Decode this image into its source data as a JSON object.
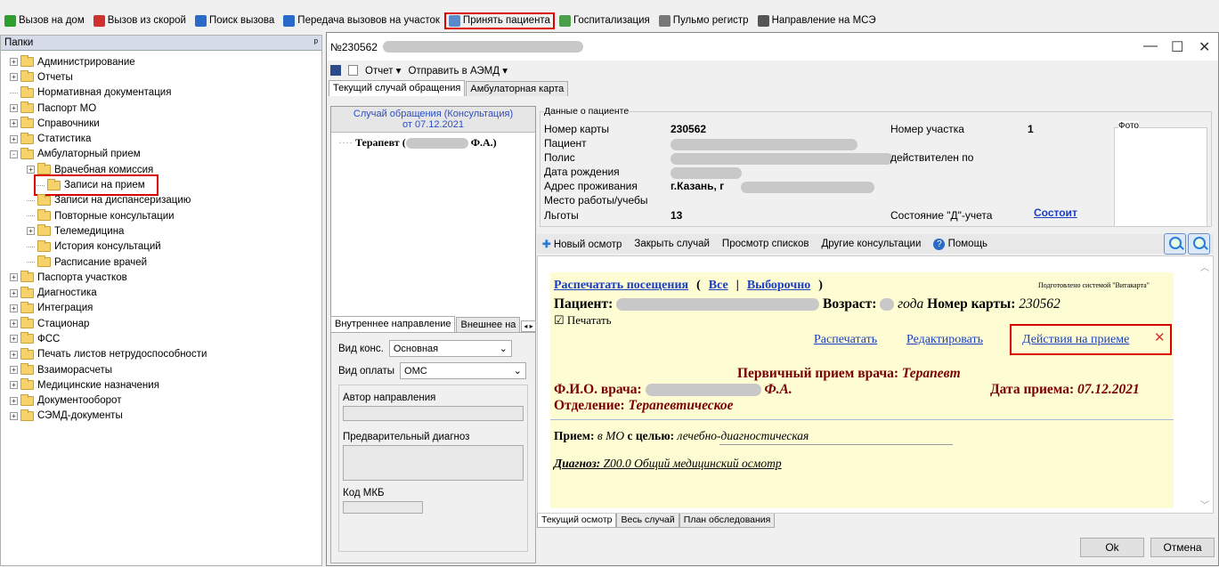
{
  "toolbar": {
    "items": [
      {
        "label": "Вызов на дом",
        "color": "#2e9e2e"
      },
      {
        "label": "Вызов из скорой",
        "color": "#d03030"
      },
      {
        "label": "Поиск вызова",
        "color": "#2a6ac8"
      },
      {
        "label": "Передача вызовов на участок",
        "color": "#2a6ac8"
      },
      {
        "label": "Принять пациента",
        "color": "#5a8ac8"
      },
      {
        "label": "Госпитализация",
        "color": "#4aa04a"
      },
      {
        "label": "Пульмо регистр",
        "color": "#777777"
      },
      {
        "label": "Направление на МСЭ",
        "color": "#555555"
      }
    ]
  },
  "leftpanel": {
    "title": "Папки",
    "pin": "ᵖ",
    "tree": [
      {
        "label": "Администрирование",
        "level": 0,
        "expander": "+"
      },
      {
        "label": "Отчеты",
        "level": 0,
        "expander": "+"
      },
      {
        "label": "Нормативная документация",
        "level": 0,
        "expander": ""
      },
      {
        "label": "Паспорт МО",
        "level": 0,
        "expander": "+"
      },
      {
        "label": "Справочники",
        "level": 0,
        "expander": "+"
      },
      {
        "label": "Статистика",
        "level": 0,
        "expander": "+"
      },
      {
        "label": "Амбулаторный прием",
        "level": 0,
        "expander": "-"
      },
      {
        "label": "Врачебная комиссия",
        "level": 1,
        "expander": "+"
      },
      {
        "label": "Записи на прием",
        "level": 1,
        "expander": ""
      },
      {
        "label": "Записи на диспансеризацию",
        "level": 1,
        "expander": ""
      },
      {
        "label": "Повторные консультации",
        "level": 1,
        "expander": ""
      },
      {
        "label": "Телемедицина",
        "level": 1,
        "expander": "+"
      },
      {
        "label": "История консультаций",
        "level": 1,
        "expander": ""
      },
      {
        "label": "Расписание врачей",
        "level": 1,
        "expander": ""
      },
      {
        "label": "Паспорта участков",
        "level": 0,
        "expander": "+"
      },
      {
        "label": "Диагностика",
        "level": 0,
        "expander": "+"
      },
      {
        "label": "Интеграция",
        "level": 0,
        "expander": "+"
      },
      {
        "label": "Стационар",
        "level": 0,
        "expander": "+"
      },
      {
        "label": "ФСС",
        "level": 0,
        "expander": "+"
      },
      {
        "label": "Печать листов нетрудоспособности",
        "level": 0,
        "expander": "+"
      },
      {
        "label": "Взаиморасчеты",
        "level": 0,
        "expander": "+"
      },
      {
        "label": "Медицинские назначения",
        "level": 0,
        "expander": "+"
      },
      {
        "label": "Документооборот",
        "level": 0,
        "expander": "+"
      },
      {
        "label": "СЭМД-документы",
        "level": 0,
        "expander": "+"
      }
    ]
  },
  "window": {
    "title": "№230562",
    "minimize": "—",
    "maximize": "☐",
    "close": "✕",
    "report": "Отчет ▾",
    "send": "Отправить в АЭМД ▾",
    "tab_current": "Текущий случай обращения",
    "tab_card": "Амбулаторная карта"
  },
  "case": {
    "head1": "Случай обращения (Консультация)",
    "head2": "от 07.12.2021",
    "item_prefix": "Терапевт (",
    "item_suffix": "Ф.А.)"
  },
  "direction": {
    "tab_internal": "Внутреннее направление",
    "tab_external": "Внешнее на",
    "vid_kons_label": "Вид конс.",
    "vid_kons_value": "Основная",
    "vid_opl_label": "Вид оплаты",
    "vid_opl_value": "ОМС",
    "author_label": "Автор направления",
    "diag_label": "Предварительный диагноз",
    "mkb_label": "Код МКБ"
  },
  "patient": {
    "legend": "Данные о пациенте",
    "card_label": "Номер карты",
    "card_value": "230562",
    "patient_label": "Пациент",
    "policy_label": "Полис",
    "birth_label": "Дата рождения",
    "address_label": "Адрес проживания",
    "address_value": "г.Казань, г",
    "work_label": "Место работы/учебы",
    "benefits_label": "Льготы",
    "benefits_value": "13",
    "area_label": "Номер участка",
    "area_value": "1",
    "valid_label": "действителен по",
    "d_label": "Состояние \"Д\"-учета",
    "d_value": "Состоит",
    "photo_label": "Фото"
  },
  "actions": {
    "new_exam": "Новый осмотр",
    "close_case": "Закрыть случай",
    "view_lists": "Просмотр списков",
    "other_kons": "Другие консультации",
    "help": "Помощь"
  },
  "doc": {
    "print_visits": "Распечатать посещения",
    "paren_open": "(",
    "all": "Все",
    "sep": "|",
    "selective": "Выборочно",
    "paren_close": ")",
    "prepared": "Подготовлено системой \"Витакарта\"",
    "patient_label": "Пациент:",
    "age_label": "Возраст:",
    "age_suffix": "года",
    "card_label": "Номер карты:",
    "card_value": "230562",
    "print_check": "Печатать",
    "print_link": "Распечатать",
    "edit_link": "Редактировать",
    "actions_link": "Действия на приеме",
    "close_x": "✕",
    "heading_label": "Первичный прием врача:",
    "heading_value": "Терапевт",
    "doctor_label": "Ф.И.О. врача:",
    "doctor_suffix": "Ф.А.",
    "date_label": "Дата приема:",
    "date_value": "07.12.2021",
    "dept_label": "Отделение:",
    "dept_value": "Терапевтическое",
    "reception_label": "Прием:",
    "reception_place": "в МО",
    "purpose_label": "с целью:",
    "purpose_value": "лечебно-диагностическая",
    "diag_label": "Диагноз:",
    "diag_value": "Z00.0 Общий медицинский осмотр"
  },
  "bottom_tabs": [
    "Текущий осмотр",
    "Весь случай",
    "План обследования"
  ],
  "buttons": {
    "ok": "Ok",
    "cancel": "Отмена"
  }
}
